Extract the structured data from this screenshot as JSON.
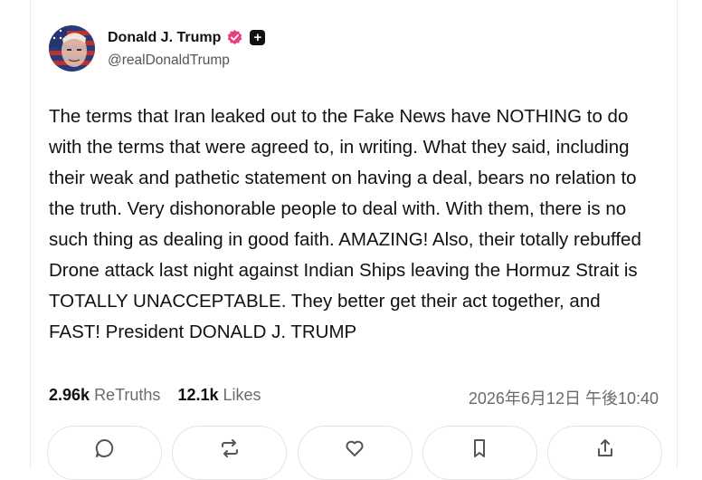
{
  "author": {
    "display_name": "Donald J. Trump",
    "handle": "@realDonaldTrump",
    "avatar_icon": "avatar-flag-portrait",
    "verified_icon": "verified-badge-icon",
    "verified_color": "#e8407f",
    "plus_badge": "+"
  },
  "post": {
    "text": "The terms that Iran leaked out to the Fake News have NOTHING to do with the terms that were agreed to, in writing. What they said, including their weak and pathetic statement on having a deal, bears no relation to the truth. Very dishonorable people to deal with. With them, there is no such thing as dealing in good faith. AMAZING! Also, their totally rebuffed Drone attack last night against Indian Ships leaving the Hormuz Strait is TOTALLY UNACCEPTABLE. They better get their act together, and FAST! President DONALD J. TRUMP"
  },
  "stats": {
    "retruths_count": "2.96k",
    "retruths_label": "ReTruths",
    "likes_count": "12.1k",
    "likes_label": "Likes",
    "timestamp": "2026年6月12日 午後10:40"
  },
  "actions": [
    {
      "icon": "reply-icon"
    },
    {
      "icon": "retruth-icon"
    },
    {
      "icon": "like-icon"
    },
    {
      "icon": "bookmark-icon"
    },
    {
      "icon": "share-icon"
    }
  ]
}
